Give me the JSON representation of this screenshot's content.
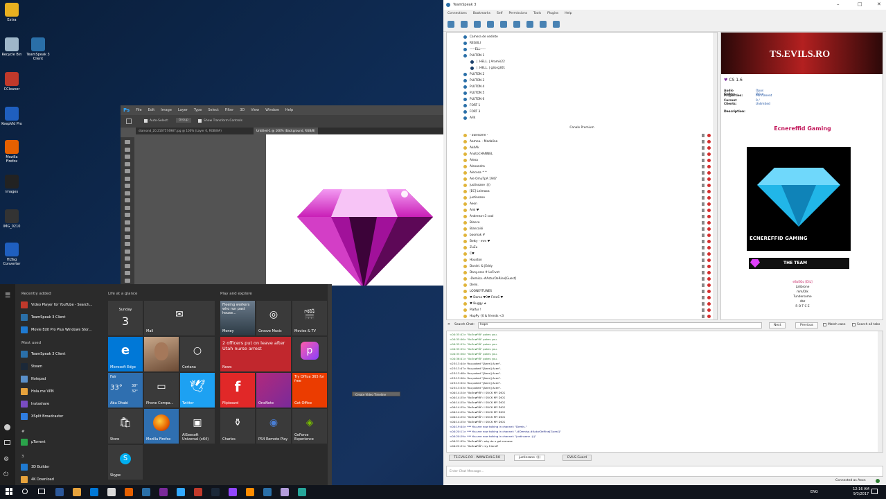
{
  "desktop": {
    "icons": [
      {
        "label": "Extra",
        "color": "#e8b020"
      },
      {
        "label": "Recycle Bin",
        "color": "#9fb7c9"
      },
      {
        "label": "TeamSpeak 3 Client",
        "color": "#2a6fa8"
      },
      {
        "label": "CCleaner",
        "color": "#c0392b"
      },
      {
        "label": "KeepVid Pro",
        "color": "#1f5fbf"
      },
      {
        "label": "Mozilla Firefox",
        "color": "#e66000"
      },
      {
        "label": "images",
        "color": "#222222"
      },
      {
        "label": "IMG_0210",
        "color": "#333333"
      },
      {
        "label": "HLTag Converter",
        "color": "#1f5fbf"
      }
    ]
  },
  "photoshop": {
    "logo": "Ps",
    "menu": [
      "File",
      "Edit",
      "Image",
      "Layer",
      "Type",
      "Select",
      "Filter",
      "3D",
      "View",
      "Window",
      "Help"
    ],
    "options": {
      "auto_select": "Auto-Select:",
      "group": "Group",
      "transform": "Show Transform Controls"
    },
    "tabs": [
      "diamond_20.2167574987.jpg @ 100% (Layer 0, RGB/8#)",
      "Untitled-1 @ 100% (Background, RGB/8)"
    ],
    "timeline_button": "Create Video Timeline"
  },
  "start_menu": {
    "recently_added_title": "Recently added",
    "recently_added": [
      {
        "label": "Video Player for YouTube - Search...",
        "color": "#c0392b"
      },
      {
        "label": "TeamSpeak 3 Client",
        "color": "#2a6fa8"
      },
      {
        "label": "Movie Edit Pro Plus Windows Stor...",
        "color": "#1f7ad1"
      }
    ],
    "most_used_title": "Most used",
    "most_used": [
      {
        "label": "TeamSpeak 3 Client",
        "color": "#2a6fa8"
      },
      {
        "label": "Steam",
        "color": "#1b2838"
      },
      {
        "label": "Notepad",
        "color": "#5a8fc8"
      },
      {
        "label": "Hola.me VPN",
        "color": "#e6a23c"
      },
      {
        "label": "Instashare",
        "color": "#7a4cc2"
      },
      {
        "label": "XSplit Broadcaster",
        "color": "#2f7de1"
      }
    ],
    "letter_hash": "#",
    "hash_items": [
      {
        "label": "µTorrent",
        "color": "#2aa34a"
      }
    ],
    "letter_3": "3",
    "three_items": [
      {
        "label": "3D Builder",
        "color": "#1f7ad1"
      },
      {
        "label": "4K Download",
        "color": "#e6a23c"
      }
    ],
    "life_title": "Life at a glance",
    "play_title": "Play and explore",
    "tiles": {
      "calendar_day": "Sunday",
      "calendar_date": "3",
      "mail": "Mail",
      "edge": "Microsoft Edge",
      "cortana": "Cortana",
      "weather_cond": "Fair",
      "weather_temp": "33°",
      "weather_hi": "38°",
      "weather_lo": "32°",
      "weather_city": "Abu Dhabi",
      "phone": "Phone Compa...",
      "twitter": "Twitter",
      "store": "Store",
      "firefox": "Mozilla Firefox",
      "aiseesoft": "AiSeesoft Universal (x64)",
      "skype": "Skype",
      "money_text": "Fleeing workers who run past house...",
      "money": "Money",
      "groove": "Groove Music",
      "movies": "Movies & TV",
      "news_text": "2 officers put on leave after Utah nurse arrest",
      "news": "News",
      "picsart": "PicsArt",
      "flipboard": "Flipboard",
      "onenote": "OneNote",
      "office": "Get Office",
      "office_text": "Try Office 365 for free",
      "charles": "Charles",
      "psremote": "PS4 Remote Play",
      "geforce": "GeForce Experience"
    }
  },
  "teamspeak": {
    "title": "TeamSpeak 3",
    "menu": [
      "Connections",
      "Bookmarks",
      "Self",
      "Permissions",
      "Tools",
      "Plugins",
      "Help"
    ],
    "tree_top": [
      {
        "label": "Camera de sedinte",
        "indent": 1
      },
      {
        "label": "REGULI",
        "indent": 1
      },
      {
        "label": "-----ELL-----",
        "indent": 1
      },
      {
        "label": "PLUTON 1",
        "indent": 1
      },
      {
        "label": "| .HELL. | Aramis22",
        "indent": 2
      },
      {
        "label": "| .HELL. | g3org301",
        "indent": 2
      },
      {
        "label": "PLUTON 2",
        "indent": 1
      },
      {
        "label": "PLUTON 3",
        "indent": 1
      },
      {
        "label": "PLUTON 4",
        "indent": 1
      },
      {
        "label": "PLUTON 5",
        "indent": 1
      },
      {
        "label": "PLUTON 6",
        "indent": 1
      },
      {
        "label": "FORT 1",
        "indent": 1
      },
      {
        "label": "FORT 3",
        "indent": 1
      },
      {
        "label": "AFK",
        "indent": 1
      }
    ],
    "spacer_label": "Canale Premium",
    "tree_premium": [
      "- awesome -",
      "Aamna. - Madalina",
      "Ak4Ak",
      "AnatoCHANNEL",
      "Alexa",
      "Alexandra",
      "Alecsea ^^",
      "Ale OmuTpA 1947",
      "justinsane :)))",
      "[EC] Leimaxa",
      "justinsane",
      "Aeon",
      "Ami ♥",
      "Andreea<3 cool",
      "Bianco",
      "Biancaiki",
      "boomak #",
      "Betty - mm ♥",
      "ZuZu",
      "C♥",
      "Houston",
      "Daniel. & jEddy",
      "Dany.ssss # LeFrvet",
      "-Demisa.-#AsturDeRine[Guest]",
      "Demi.",
      "LOONEYTUNES",
      "♥ Dama ♥0♥ FetoS ♥",
      "♥ Buggy ★",
      "Pialfur !",
      "HapPy {0 & friends <3"
    ],
    "info": {
      "banner": "TS.EVILS.RO",
      "channel": "CS 1.6",
      "rows": [
        {
          "k": "Audio Codec:",
          "v": "Opus Voice"
        },
        {
          "k": "Properties:",
          "v": "Permanent"
        },
        {
          "k": "Current Clients:",
          "v": "0 / Unlimited"
        }
      ],
      "desc": "Description:",
      "gaming": "Ecnereffid Gaming",
      "logo_text": "ECNEREFFID GAMING",
      "team": "THE TEAM",
      "names": [
        "eSoEGo [DIL]",
        "Lalibrone",
        "mm/Dik",
        "Tundersome",
        "dbz",
        "R O T C E"
      ]
    },
    "search": {
      "label": "Search Chat:",
      "value": "hapn",
      "next": "Next",
      "previous": "Previous",
      "match_case": "Match case",
      "search_all": "Search all tabs"
    },
    "chat": [
      "<00:35:02> \"ßx3nøFfå\" pokes you.",
      "<00:35:06> \"ßx3nøFfå\" pokes you.",
      "<00:35:53> \"ßx3nøFfå\" pokes you.",
      "<00:35:55> \"ßx3nøFfå\" pokes you.",
      "<00:35:56> \"ßx3nøFfå\" pokes you.",
      "<00:36:01> \"ßx3nøFfå\" pokes you.",
      "<23:13:44> You poked \"[Azen] Acen\".",
      "<23:13:47> You poked \"[Azen] Acen\".",
      "<23:13:48> You poked \"[Azen] Acen\".",
      "<23:13:50> You poked \"[Azen] Acen\".",
      "<23:13:52> You poked \"[Azen] Acen\".",
      "<23:13:53> You poked \"[Azen] Acen\".",
      "<00:14:24> \"ßx3nøFfå\": I SUCK MY DICK",
      "<00:14:25> \"ßx3nøFfå\": I SUCK MY DICK",
      "<00:14:25> \"ßx3nøFfå\": I SUCK MY DICK",
      "<00:14:25> \"ßx3nøFfå\": I SUCK MY DICK",
      "<00:14:25> \"ßx3nøFfå\": I SUCK MY DICK",
      "<00:14:25> \"ßx3nøFfå\": I SUCK MY DICK",
      "<00:14:25> \"ßx3nøFfå\": I SUCK MY DICK",
      "<00:19:04> *** You are now talking in channel: \"Demis.\"",
      "<00:20:11> *** You are now talking in channel: \"-#Demisa.#AsturDeRine[Guest]\"",
      "<00:20:29> *** You are now talking in channel: \"justinsane :)))\"",
      "<00:21:55> \"ßx3nøFfå\": why do u get remove",
      "<00:22:21> \"ßx3nøFfå\": my friend?"
    ],
    "chat_tabs": [
      "TS.EVILS.RO - WWW.EVILS.RO",
      "justinsane :)))",
      "EVILS-Guard"
    ],
    "input_placeholder": "Enter Chat Message...",
    "status": "Connected as Aeon"
  },
  "taskbar": {
    "time": "12:16 AM",
    "date": "9/3/2017",
    "lang": "ENG"
  }
}
